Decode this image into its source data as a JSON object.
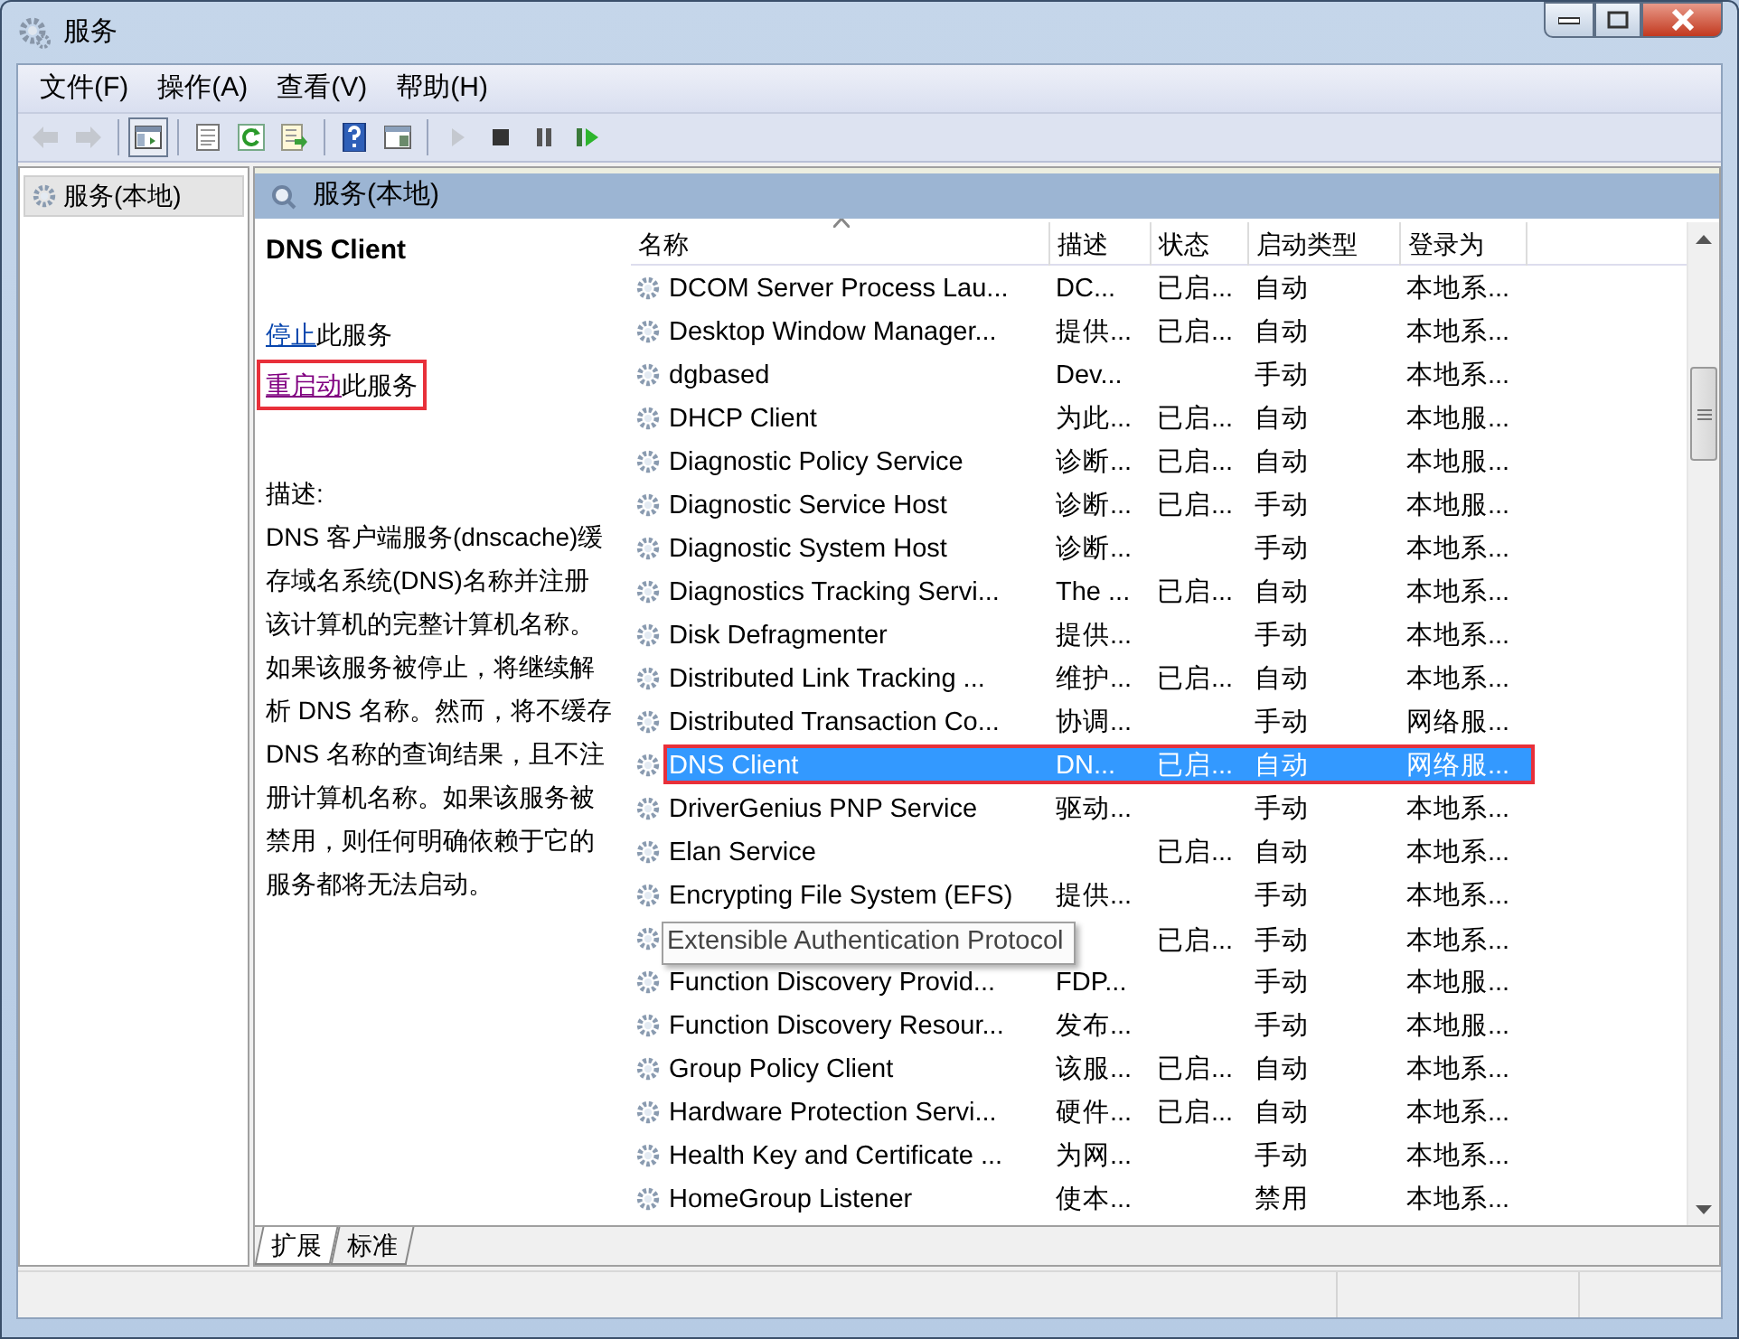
{
  "window": {
    "title": "服务"
  },
  "menu": [
    "文件(F)",
    "操作(A)",
    "查看(V)",
    "帮助(H)"
  ],
  "toolbar": [
    {
      "kind": "back",
      "disabled": true,
      "pressed": false
    },
    {
      "kind": "forward",
      "disabled": true,
      "pressed": false
    },
    {
      "kind": "separator"
    },
    {
      "kind": "tree",
      "disabled": false,
      "pressed": true
    },
    {
      "kind": "separator"
    },
    {
      "kind": "properties",
      "disabled": false,
      "pressed": false
    },
    {
      "kind": "refresh",
      "disabled": false,
      "pressed": false
    },
    {
      "kind": "export",
      "disabled": false,
      "pressed": false
    },
    {
      "kind": "separator"
    },
    {
      "kind": "help",
      "disabled": false,
      "pressed": false
    },
    {
      "kind": "console",
      "disabled": false,
      "pressed": false
    },
    {
      "kind": "separator"
    },
    {
      "kind": "start",
      "disabled": true,
      "pressed": false
    },
    {
      "kind": "stop",
      "disabled": false,
      "pressed": false
    },
    {
      "kind": "pause",
      "disabled": false,
      "pressed": false
    },
    {
      "kind": "restart",
      "disabled": false,
      "pressed": false
    }
  ],
  "tree": [
    {
      "label": "服务(本地)",
      "selected": true
    }
  ],
  "panel_header": "服务(本地)",
  "details": {
    "title": "DNS Client",
    "actions": [
      {
        "link": "停止",
        "text": "此服务",
        "visited": false,
        "annotated": false
      },
      {
        "link": "重启动",
        "text": "此服务",
        "visited": true,
        "annotated": true
      }
    ],
    "description_label": "描述:",
    "description": "DNS 客户端服务(dnscache)缓存域名系统(DNS)名称并注册该计算机的完整计算机名称。如果该服务被停止，将继续解析 DNS 名称。然而，将不缓存 DNS 名称的查询结果，且不注册计算机名称。如果该服务被禁用，则任何明确依赖于它的服务都将无法启动。"
  },
  "table": {
    "columns": [
      {
        "label": "名称",
        "sorted": true
      },
      {
        "label": "描述",
        "sorted": false
      },
      {
        "label": "状态",
        "sorted": false
      },
      {
        "label": "启动类型",
        "sorted": false
      },
      {
        "label": "登录为",
        "sorted": false
      }
    ],
    "rows": [
      {
        "name": "DCOM Server Process Lau...",
        "description": "DC...",
        "status": "已启...",
        "startup": "自动",
        "logon": "本地系...",
        "selected": false,
        "annotated": false,
        "tooltip": false
      },
      {
        "name": "Desktop Window Manager...",
        "description": "提供...",
        "status": "已启...",
        "startup": "自动",
        "logon": "本地系...",
        "selected": false,
        "annotated": false,
        "tooltip": false
      },
      {
        "name": "dgbased",
        "description": "Dev...",
        "status": "",
        "startup": "手动",
        "logon": "本地系...",
        "selected": false,
        "annotated": false,
        "tooltip": false
      },
      {
        "name": "DHCP Client",
        "description": "为此...",
        "status": "已启...",
        "startup": "自动",
        "logon": "本地服...",
        "selected": false,
        "annotated": false,
        "tooltip": false
      },
      {
        "name": "Diagnostic Policy Service",
        "description": "诊断...",
        "status": "已启...",
        "startup": "自动",
        "logon": "本地服...",
        "selected": false,
        "annotated": false,
        "tooltip": false
      },
      {
        "name": "Diagnostic Service Host",
        "description": "诊断...",
        "status": "已启...",
        "startup": "手动",
        "logon": "本地服...",
        "selected": false,
        "annotated": false,
        "tooltip": false
      },
      {
        "name": "Diagnostic System Host",
        "description": "诊断...",
        "status": "",
        "startup": "手动",
        "logon": "本地系...",
        "selected": false,
        "annotated": false,
        "tooltip": false
      },
      {
        "name": "Diagnostics Tracking Servi...",
        "description": "The ...",
        "status": "已启...",
        "startup": "自动",
        "logon": "本地系...",
        "selected": false,
        "annotated": false,
        "tooltip": false
      },
      {
        "name": "Disk Defragmenter",
        "description": "提供...",
        "status": "",
        "startup": "手动",
        "logon": "本地系...",
        "selected": false,
        "annotated": false,
        "tooltip": false
      },
      {
        "name": "Distributed Link Tracking ...",
        "description": "维护...",
        "status": "已启...",
        "startup": "自动",
        "logon": "本地系...",
        "selected": false,
        "annotated": false,
        "tooltip": false
      },
      {
        "name": "Distributed Transaction Co...",
        "description": "协调...",
        "status": "",
        "startup": "手动",
        "logon": "网络服...",
        "selected": false,
        "annotated": false,
        "tooltip": false
      },
      {
        "name": "DNS Client",
        "description": "DN...",
        "status": "已启...",
        "startup": "自动",
        "logon": "网络服...",
        "selected": true,
        "annotated": true,
        "tooltip": false
      },
      {
        "name": "DriverGenius PNP Service",
        "description": "驱动...",
        "status": "",
        "startup": "手动",
        "logon": "本地系...",
        "selected": false,
        "annotated": false,
        "tooltip": false
      },
      {
        "name": "Elan Service",
        "description": "",
        "status": "已启...",
        "startup": "自动",
        "logon": "本地系...",
        "selected": false,
        "annotated": false,
        "tooltip": false
      },
      {
        "name": "Encrypting File System (EFS)",
        "description": "提供...",
        "status": "",
        "startup": "手动",
        "logon": "本地系...",
        "selected": false,
        "annotated": false,
        "tooltip": false
      },
      {
        "name": "Extensible Authentication Protocol",
        "description": "",
        "status": "已启...",
        "startup": "手动",
        "logon": "本地系...",
        "selected": false,
        "annotated": false,
        "tooltip": true
      },
      {
        "name": "Function Discovery Provid...",
        "description": "FDP...",
        "status": "",
        "startup": "手动",
        "logon": "本地服...",
        "selected": false,
        "annotated": false,
        "tooltip": false
      },
      {
        "name": "Function Discovery Resour...",
        "description": "发布...",
        "status": "",
        "startup": "手动",
        "logon": "本地服...",
        "selected": false,
        "annotated": false,
        "tooltip": false
      },
      {
        "name": "Group Policy Client",
        "description": "该服...",
        "status": "已启...",
        "startup": "自动",
        "logon": "本地系...",
        "selected": false,
        "annotated": false,
        "tooltip": false
      },
      {
        "name": "Hardware Protection Servi...",
        "description": "硬件...",
        "status": "已启...",
        "startup": "自动",
        "logon": "本地系...",
        "selected": false,
        "annotated": false,
        "tooltip": false
      },
      {
        "name": "Health Key and Certificate ...",
        "description": "为网...",
        "status": "",
        "startup": "手动",
        "logon": "本地系...",
        "selected": false,
        "annotated": false,
        "tooltip": false
      },
      {
        "name": "HomeGroup Listener",
        "description": "使本...",
        "status": "",
        "startup": "禁用",
        "logon": "本地系...",
        "selected": false,
        "annotated": false,
        "tooltip": false
      }
    ]
  },
  "tabs": [
    {
      "label": "扩展",
      "selected": true
    },
    {
      "label": "标准",
      "selected": false
    }
  ]
}
